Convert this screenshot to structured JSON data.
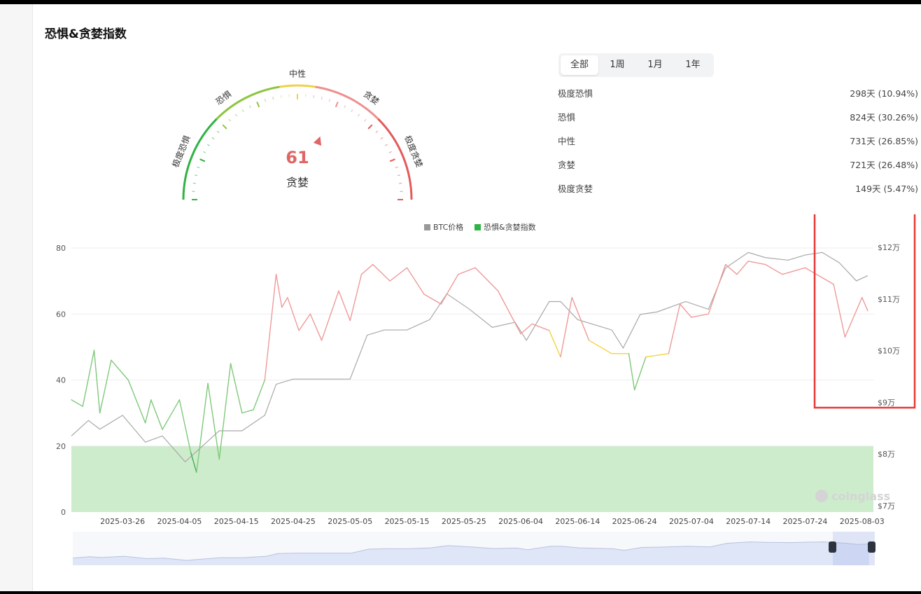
{
  "page": {
    "title": "恐惧&贪婪指数"
  },
  "gauge": {
    "value": 61,
    "value_label": "61",
    "sentiment": "贪婪",
    "zone_labels": [
      "极度恐惧",
      "恐惧",
      "中性",
      "贪婪",
      "极度贪婪"
    ],
    "colors": {
      "extreme_fear": "#2fb344",
      "fear": "#8cc63f",
      "neutral": "#f0d24a",
      "greed": "#ef8f8f",
      "extreme_greed": "#e35a5a",
      "value_text": "#e06666"
    }
  },
  "tabs": [
    {
      "label": "全部",
      "active": true
    },
    {
      "label": "1周",
      "active": false
    },
    {
      "label": "1月",
      "active": false
    },
    {
      "label": "1年",
      "active": false
    }
  ],
  "stats": [
    {
      "label": "极度恐惧",
      "value": "298天 (10.94%)"
    },
    {
      "label": "恐惧",
      "value": "824天 (30.26%)"
    },
    {
      "label": "中性",
      "value": "731天 (26.85%)"
    },
    {
      "label": "贪婪",
      "value": "721天 (26.48%)"
    },
    {
      "label": "极度贪婪",
      "value": "149天 (5.47%)"
    }
  ],
  "chart_data": {
    "type": "line",
    "legend": [
      "BTC价格",
      "恐惧&贪婪指数"
    ],
    "legend_position": "top-center",
    "x_ticks": [
      "2025-03-26",
      "2025-04-05",
      "2025-04-15",
      "2025-04-25",
      "2025-05-05",
      "2025-05-15",
      "2025-05-25",
      "2025-06-04",
      "2025-06-14",
      "2025-06-24",
      "2025-07-04",
      "2025-07-14",
      "2025-07-24",
      "2025-08-03"
    ],
    "x_range": [
      "2025-03-17",
      "2025-08-05"
    ],
    "y_left": {
      "ticks": [
        "0",
        "20",
        "40",
        "60",
        "80"
      ],
      "range": [
        0,
        80
      ]
    },
    "y_right": {
      "ticks": [
        "$7万",
        "$8万",
        "$9万",
        "$10万",
        "$11万",
        "$12万"
      ],
      "range": [
        70000,
        120000
      ]
    },
    "fear_zone": [
      0,
      20
    ],
    "series": [
      {
        "name": "恐惧&贪婪指数",
        "dates": [
          "2025-03-17",
          "2025-03-19",
          "2025-03-21",
          "2025-03-22",
          "2025-03-24",
          "2025-03-27",
          "2025-03-30",
          "2025-03-31",
          "2025-04-02",
          "2025-04-05",
          "2025-04-07",
          "2025-04-08",
          "2025-04-10",
          "2025-04-12",
          "2025-04-14",
          "2025-04-16",
          "2025-04-18",
          "2025-04-20",
          "2025-04-22",
          "2025-04-23",
          "2025-04-24",
          "2025-04-26",
          "2025-04-28",
          "2025-04-30",
          "2025-05-03",
          "2025-05-05",
          "2025-05-07",
          "2025-05-09",
          "2025-05-12",
          "2025-05-15",
          "2025-05-18",
          "2025-05-21",
          "2025-05-24",
          "2025-05-27",
          "2025-05-31",
          "2025-06-04",
          "2025-06-06",
          "2025-06-09",
          "2025-06-11",
          "2025-06-13",
          "2025-06-16",
          "2025-06-20",
          "2025-06-23",
          "2025-06-24",
          "2025-06-26",
          "2025-06-30",
          "2025-07-02",
          "2025-07-04",
          "2025-07-07",
          "2025-07-10",
          "2025-07-12",
          "2025-07-14",
          "2025-07-17",
          "2025-07-20",
          "2025-07-24",
          "2025-07-27",
          "2025-07-29",
          "2025-07-31",
          "2025-08-01",
          "2025-08-03",
          "2025-08-04"
        ],
        "values": [
          34,
          32,
          49,
          30,
          46,
          40,
          27,
          34,
          25,
          34,
          18,
          12,
          39,
          16,
          45,
          30,
          31,
          40,
          72,
          62,
          65,
          55,
          60,
          52,
          67,
          58,
          72,
          75,
          70,
          74,
          66,
          63,
          72,
          74,
          67,
          54,
          57,
          55,
          47,
          65,
          52,
          48,
          48,
          37,
          47,
          48,
          63,
          59,
          60,
          75,
          72,
          76,
          75,
          72,
          74,
          71,
          69,
          53,
          57,
          65,
          61
        ]
      },
      {
        "name": "BTC价格",
        "dates": [
          "2025-03-17",
          "2025-03-20",
          "2025-03-22",
          "2025-03-26",
          "2025-03-30",
          "2025-04-02",
          "2025-04-06",
          "2025-04-09",
          "2025-04-12",
          "2025-04-16",
          "2025-04-20",
          "2025-04-22",
          "2025-04-25",
          "2025-04-30",
          "2025-05-05",
          "2025-05-08",
          "2025-05-11",
          "2025-05-15",
          "2025-05-19",
          "2025-05-22",
          "2025-05-26",
          "2025-05-30",
          "2025-06-03",
          "2025-06-05",
          "2025-06-09",
          "2025-06-11",
          "2025-06-14",
          "2025-06-17",
          "2025-06-20",
          "2025-06-22",
          "2025-06-25",
          "2025-06-28",
          "2025-07-03",
          "2025-07-07",
          "2025-07-10",
          "2025-07-14",
          "2025-07-17",
          "2025-07-21",
          "2025-07-24",
          "2025-07-27",
          "2025-07-30",
          "2025-08-02",
          "2025-08-04"
        ],
        "values": [
          83500,
          86500,
          84800,
          87500,
          82300,
          83500,
          78500,
          81500,
          84500,
          84500,
          87500,
          93500,
          94500,
          94500,
          94500,
          103000,
          104000,
          104000,
          106000,
          111000,
          108000,
          104500,
          105500,
          102000,
          109500,
          109500,
          106000,
          105000,
          104000,
          100500,
          107000,
          107500,
          109500,
          108000,
          116000,
          119000,
          118000,
          117500,
          118500,
          119000,
          117000,
          113500,
          114500
        ]
      }
    ],
    "colors": {
      "btc": "#a8a8a8",
      "fear_extreme": "#3fae5a",
      "fear": "#7fc97a",
      "neutral": "#f2d43c",
      "greed": "#ef9a9a",
      "fear_zone": "#cdeccc"
    }
  },
  "watermark": "coinglass",
  "highlight_box_color": "#e53935"
}
